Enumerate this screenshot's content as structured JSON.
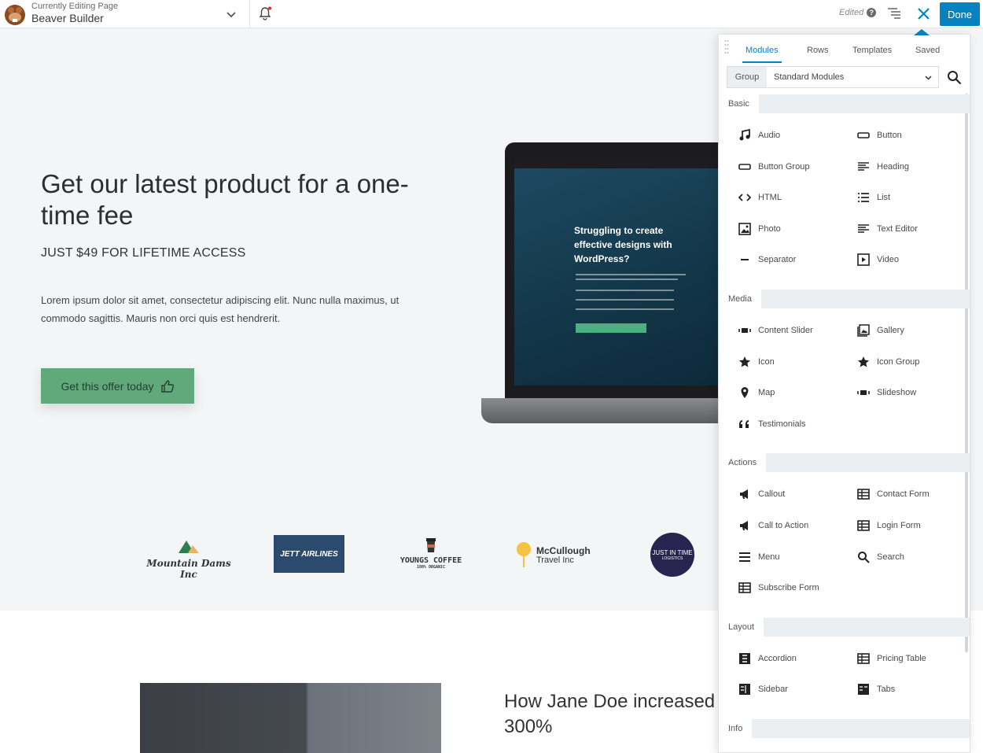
{
  "topbar": {
    "line1": "Currently Editing Page",
    "line2": "Beaver Builder",
    "status": "Edited",
    "done": "Done"
  },
  "hero": {
    "headline": "Get our latest product for a one-time fee",
    "subheading": "JUST $49 FOR LIFETIME ACCESS",
    "paragraph": "Lorem ipsum dolor sit amet, consectetur adipiscing elit. Nunc nulla maximus, ut commodo sagittis. Mauris non orci quis est hendrerit.",
    "cta": "Get this offer today",
    "laptop_headline": "Struggling to create effective designs with WordPress?"
  },
  "logos": {
    "mountain": "Mountain Dams Inc",
    "jett": "JETT AIRLINES",
    "youngs": "YOUNGS COFFEE",
    "youngs_tag": "100% ORGANIC",
    "mccullough1": "McCullough",
    "mccullough2": "Travel Inc",
    "jit1": "JUST IN TIME",
    "jit2": "LOGISTICS"
  },
  "case_study": {
    "heading": "How Jane Doe increased 300%"
  },
  "panel": {
    "tabs": [
      "Modules",
      "Rows",
      "Templates",
      "Saved"
    ],
    "group_label": "Group",
    "group_value": "Standard Modules",
    "sections": [
      {
        "name": "Basic",
        "items": [
          {
            "label": "Audio",
            "icon": "music-icon"
          },
          {
            "label": "Button",
            "icon": "button-icon"
          },
          {
            "label": "Button Group",
            "icon": "button-group-icon"
          },
          {
            "label": "Heading",
            "icon": "heading-icon"
          },
          {
            "label": "HTML",
            "icon": "code-icon"
          },
          {
            "label": "List",
            "icon": "list-icon"
          },
          {
            "label": "Photo",
            "icon": "photo-icon"
          },
          {
            "label": "Text Editor",
            "icon": "text-editor-icon"
          },
          {
            "label": "Separator",
            "icon": "separator-icon"
          },
          {
            "label": "Video",
            "icon": "video-icon"
          }
        ]
      },
      {
        "name": "Media",
        "items": [
          {
            "label": "Content Slider",
            "icon": "slider-icon"
          },
          {
            "label": "Gallery",
            "icon": "gallery-icon"
          },
          {
            "label": "Icon",
            "icon": "star-icon"
          },
          {
            "label": "Icon Group",
            "icon": "star-icon"
          },
          {
            "label": "Map",
            "icon": "map-pin-icon"
          },
          {
            "label": "Slideshow",
            "icon": "slider-icon"
          },
          {
            "label": "Testimonials",
            "icon": "quote-icon"
          }
        ]
      },
      {
        "name": "Actions",
        "items": [
          {
            "label": "Callout",
            "icon": "megaphone-icon"
          },
          {
            "label": "Contact Form",
            "icon": "form-icon"
          },
          {
            "label": "Call to Action",
            "icon": "megaphone-icon"
          },
          {
            "label": "Login Form",
            "icon": "form-icon"
          },
          {
            "label": "Menu",
            "icon": "menu-icon"
          },
          {
            "label": "Search",
            "icon": "search-icon"
          },
          {
            "label": "Subscribe Form",
            "icon": "form-icon"
          }
        ]
      },
      {
        "name": "Layout",
        "items": [
          {
            "label": "Accordion",
            "icon": "accordion-icon"
          },
          {
            "label": "Pricing Table",
            "icon": "table-icon"
          },
          {
            "label": "Sidebar",
            "icon": "sidebar-icon"
          },
          {
            "label": "Tabs",
            "icon": "tabs-icon"
          }
        ]
      },
      {
        "name": "Info",
        "items": []
      }
    ]
  },
  "colors": {
    "accent": "#0782c1",
    "cta": "#5fa97b",
    "section_bg": "#eceff2"
  }
}
